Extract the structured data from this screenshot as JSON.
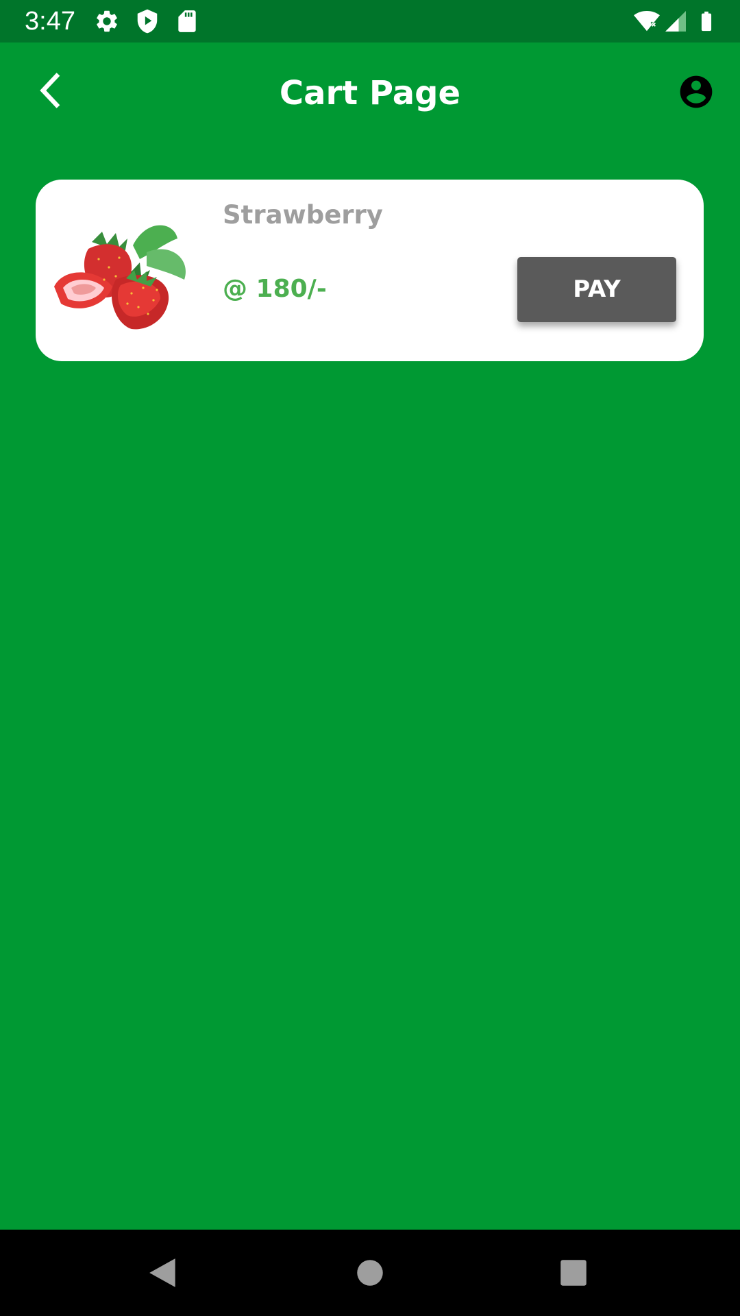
{
  "status_bar": {
    "time": "3:47",
    "icons": [
      "settings-icon",
      "shield-play-icon",
      "sd-card-icon",
      "wifi-icon",
      "cellular-signal-icon",
      "battery-icon"
    ]
  },
  "app_bar": {
    "title": "Cart Page",
    "back_icon": "chevron-left-icon",
    "account_icon": "account-circle-icon"
  },
  "cart": {
    "items": [
      {
        "name": "Strawberry",
        "price": "@ 180/-",
        "image": "strawberry-image",
        "action_label": "PAY"
      }
    ]
  },
  "nav_bar": {
    "icons": [
      "back-triangle-icon",
      "home-circle-icon",
      "recents-square-icon"
    ]
  },
  "colors": {
    "background": "#009933",
    "status_bar": "#00752a",
    "card": "#ffffff",
    "product_name": "#9e9e9e",
    "price": "#4caf50",
    "pay_button": "#5a5a5a",
    "nav_bar": "#000000"
  }
}
